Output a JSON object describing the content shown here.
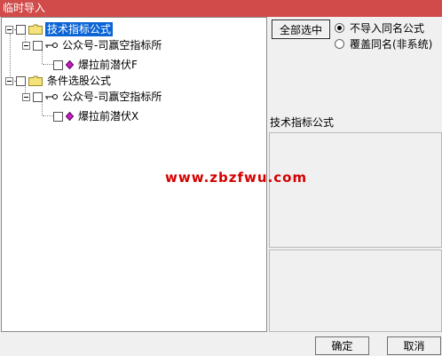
{
  "window": {
    "title": "临时导入"
  },
  "tree": {
    "groups": [
      {
        "label": "技术指标公式",
        "selected": true,
        "children": [
          {
            "label": "公众号-司赢空指标所",
            "children": [
              {
                "label": "爆拉前潜伏F"
              }
            ]
          }
        ]
      },
      {
        "label": "条件选股公式",
        "selected": false,
        "children": [
          {
            "label": "公众号-司赢空指标所",
            "children": [
              {
                "label": "爆拉前潜伏X"
              }
            ]
          }
        ]
      }
    ]
  },
  "options": {
    "select_all_label": "全部选中",
    "radio_skip_label": "不导入同名公式",
    "radio_overwrite_label": "覆盖同名(非系统)"
  },
  "detail": {
    "section_title": "技术指标公式"
  },
  "watermark": "www.zbzfwu.com",
  "footer": {
    "ok_label": "确定",
    "cancel_label": "取消"
  },
  "colors": {
    "titlebar": "#d14b4b",
    "selection": "#0a64d6",
    "watermark": "#d40000"
  }
}
